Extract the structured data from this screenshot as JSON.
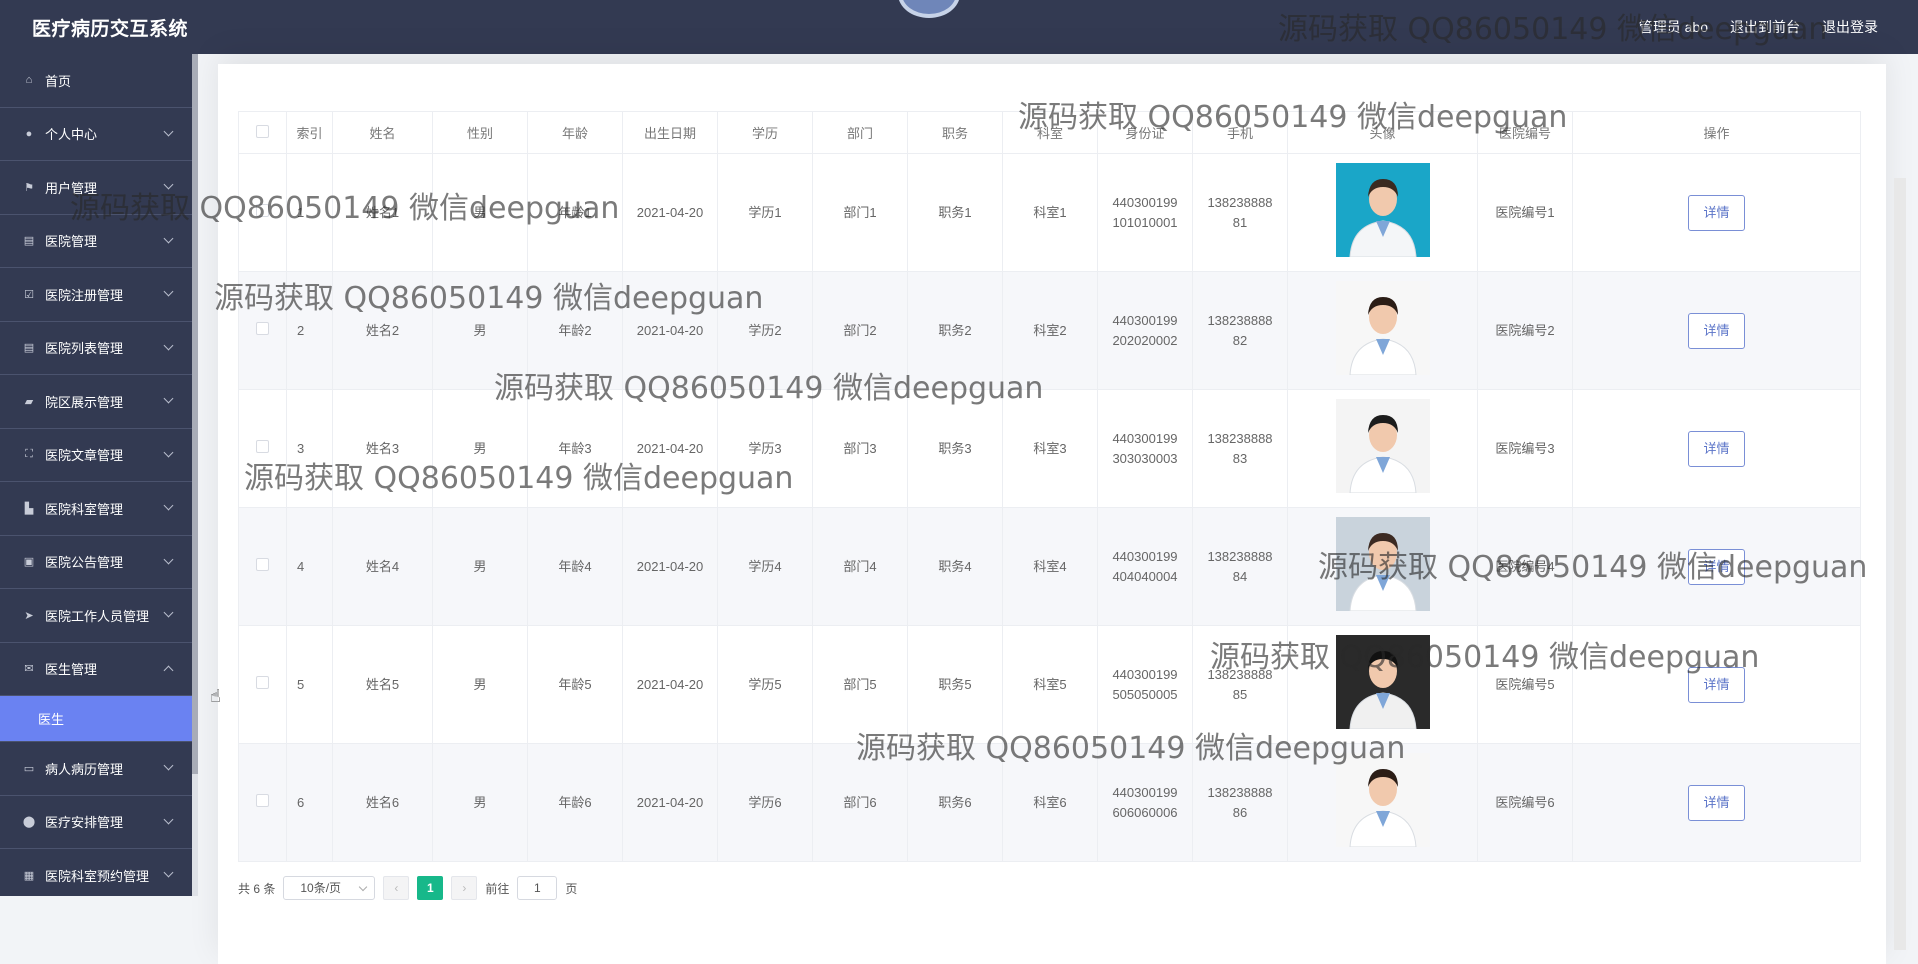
{
  "app": {
    "title": "医疗病历交互系统"
  },
  "topnav": {
    "user": "管理员 abo",
    "back": "退出到前台",
    "logout": "退出登录"
  },
  "sidebar": {
    "items": [
      {
        "label": "首页",
        "icon": "home-icon",
        "expanded": false,
        "chevron": false
      },
      {
        "label": "个人中心",
        "icon": "user-icon",
        "chevron": true
      },
      {
        "label": "用户管理",
        "icon": "flag-icon",
        "chevron": true
      },
      {
        "label": "医院管理",
        "icon": "clipboard-icon",
        "chevron": true
      },
      {
        "label": "医院注册管理",
        "icon": "checklist-icon",
        "chevron": true
      },
      {
        "label": "医院列表管理",
        "icon": "clipboard-icon",
        "chevron": true
      },
      {
        "label": "院区展示管理",
        "icon": "briefcase-icon",
        "chevron": true
      },
      {
        "label": "医院文章管理",
        "icon": "frame-icon",
        "chevron": true
      },
      {
        "label": "医院科室管理",
        "icon": "stamp-icon",
        "chevron": true
      },
      {
        "label": "医院公告管理",
        "icon": "news-icon",
        "chevron": true
      },
      {
        "label": "医院工作人员管理",
        "icon": "send-icon",
        "chevron": true
      },
      {
        "label": "医生管理",
        "icon": "mail-icon",
        "chevron": true,
        "expanded": true
      },
      {
        "label": "病人病历管理",
        "icon": "laptop-icon",
        "chevron": true
      },
      {
        "label": "医疗安排管理",
        "icon": "location-icon",
        "chevron": true
      },
      {
        "label": "医院科室预约管理",
        "icon": "grid-icon",
        "chevron": true
      }
    ],
    "sub_active": "医生"
  },
  "table": {
    "columns": [
      "索引",
      "姓名",
      "性别",
      "年龄",
      "出生日期",
      "学历",
      "部门",
      "职务",
      "科室",
      "身份证",
      "手机",
      "头像",
      "医院编号",
      "操作"
    ],
    "rows": [
      {
        "idx": "1",
        "name": "姓名1",
        "gender": "男",
        "age": "年龄1",
        "birth": "2021-04-20",
        "edu": "学历1",
        "dept": "部门1",
        "post": "职务1",
        "room": "科室1",
        "idcard": "440300199101010001",
        "phone": "13823888881",
        "hospital": "医院编号1",
        "action": "详情"
      },
      {
        "idx": "2",
        "name": "姓名2",
        "gender": "男",
        "age": "年龄2",
        "birth": "2021-04-20",
        "edu": "学历2",
        "dept": "部门2",
        "post": "职务2",
        "room": "科室2",
        "idcard": "440300199202020002",
        "phone": "13823888882",
        "hospital": "医院编号2",
        "action": "详情"
      },
      {
        "idx": "3",
        "name": "姓名3",
        "gender": "男",
        "age": "年龄3",
        "birth": "2021-04-20",
        "edu": "学历3",
        "dept": "部门3",
        "post": "职务3",
        "room": "科室3",
        "idcard": "440300199303030003",
        "phone": "13823888883",
        "hospital": "医院编号3",
        "action": "详情"
      },
      {
        "idx": "4",
        "name": "姓名4",
        "gender": "男",
        "age": "年龄4",
        "birth": "2021-04-20",
        "edu": "学历4",
        "dept": "部门4",
        "post": "职务4",
        "room": "科室4",
        "idcard": "440300199404040004",
        "phone": "13823888884",
        "hospital": "医院编号4",
        "action": "详情"
      },
      {
        "idx": "5",
        "name": "姓名5",
        "gender": "男",
        "age": "年龄5",
        "birth": "2021-04-20",
        "edu": "学历5",
        "dept": "部门5",
        "post": "职务5",
        "room": "科室5",
        "idcard": "440300199505050005",
        "phone": "13823888885",
        "hospital": "医院编号5",
        "action": "详情"
      },
      {
        "idx": "6",
        "name": "姓名6",
        "gender": "男",
        "age": "年龄6",
        "birth": "2021-04-20",
        "edu": "学历6",
        "dept": "部门6",
        "post": "职务6",
        "room": "科室6",
        "idcard": "440300199606060006",
        "phone": "13823888886",
        "hospital": "医院编号6",
        "action": "详情"
      }
    ]
  },
  "pager": {
    "total": "共 6 条",
    "page_size": "10条/页",
    "current": "1",
    "goto_label": "前往",
    "goto_value": "1",
    "page_suffix": "页"
  },
  "watermark": "源码获取 QQ86050149 微信deepguan",
  "colors": {
    "sidebar": "#333a52",
    "active_sub": "#6a82f2",
    "pager_active": "#17b88a",
    "button_border": "#7a8fd6"
  }
}
